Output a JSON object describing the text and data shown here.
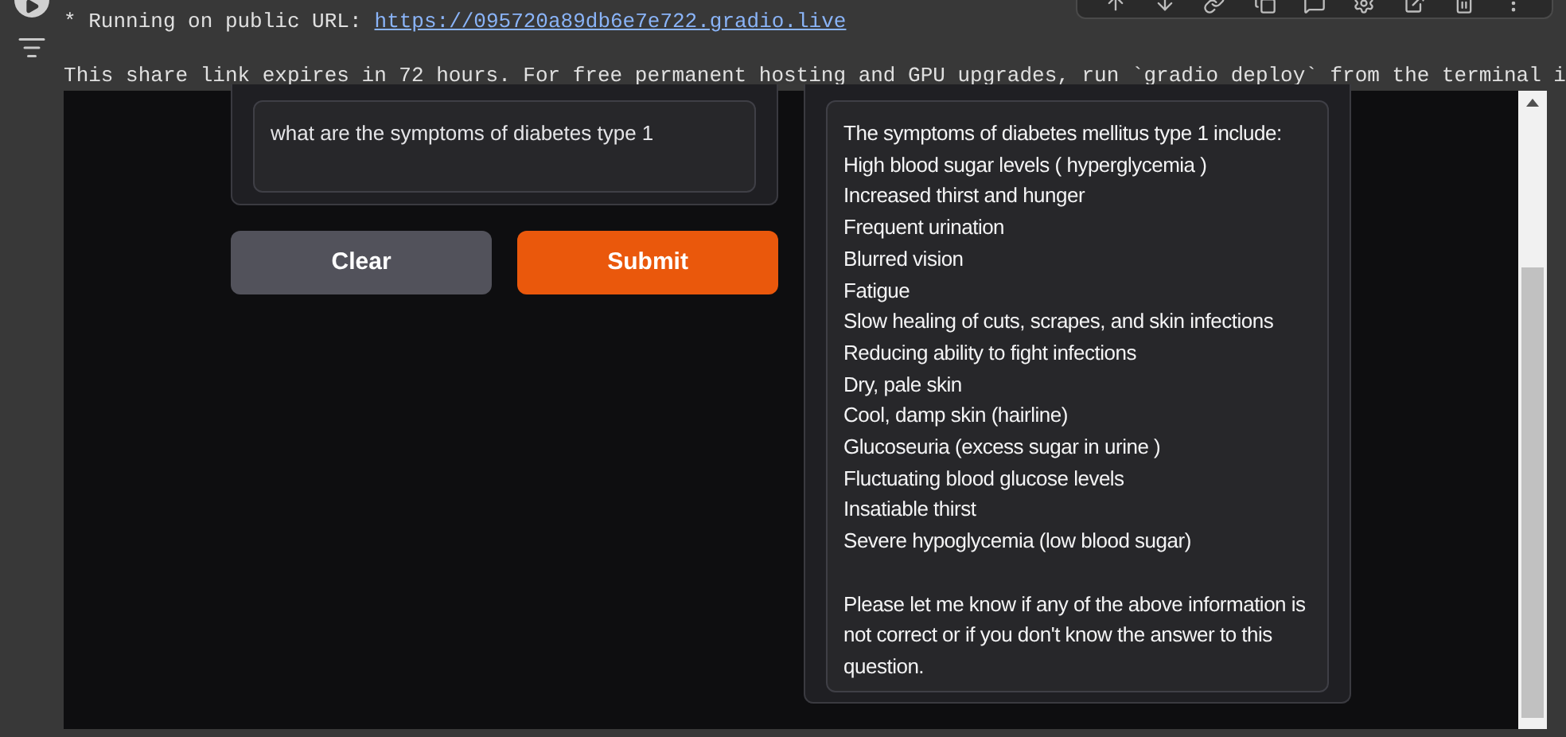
{
  "console": {
    "url_label": "* Running on public URL:",
    "url": "https://095720a89db6e7e722.gradio.live",
    "notice": "This share link expires in 72 hours. For free permanent hosting and GPU upgrades, run `gradio deploy` from the terminal i"
  },
  "input": {
    "value": "what are the symptoms of diabetes type 1"
  },
  "buttons": [
    {
      "label": "Clear",
      "kind": "secondary"
    },
    {
      "label": "Submit",
      "kind": "primary"
    }
  ],
  "output": {
    "lines": [
      "The symptoms of diabetes mellitus type 1 include:",
      "High blood sugar levels ( hyperglycemia )",
      "Increased thirst and hunger",
      "Frequent urination",
      "Blurred vision",
      "Fatigue",
      "Slow healing of cuts, scrapes, and skin infections",
      "Reducing ability to fight infections",
      "Dry, pale skin",
      "Cool, damp skin (hairline)",
      "Glucoseuria (excess sugar in urine )",
      "Fluctuating blood glucose levels",
      "Insatiable thirst",
      "Severe hypoglycemia (low blood sugar)"
    ],
    "note": "Please let me know if any of the above information is not correct or if you don't know the answer to this question."
  }
}
